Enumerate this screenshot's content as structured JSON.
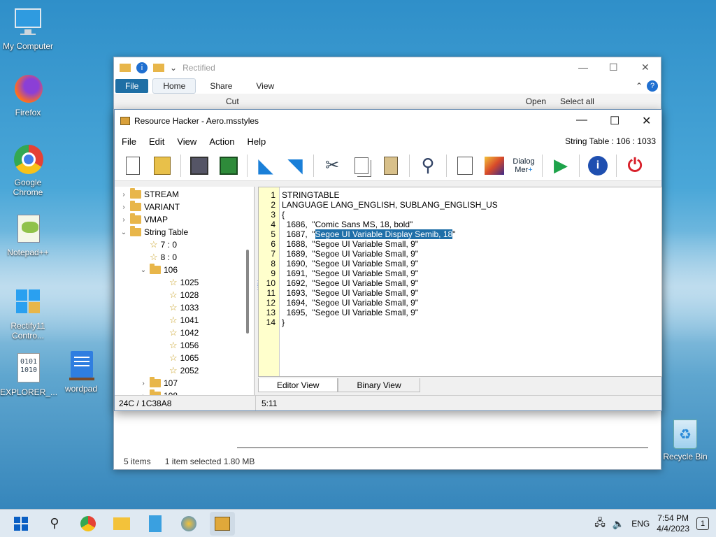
{
  "desktop": {
    "icons": [
      {
        "label": "My Computer",
        "icon": "monitor-icon"
      },
      {
        "label": "Firefox",
        "icon": "firefox-icon"
      },
      {
        "label": "Google Chrome",
        "icon": "chrome-icon"
      },
      {
        "label": "Notepad++",
        "icon": "notepadpp-icon"
      },
      {
        "label": "Rectify11 Contro...",
        "icon": "rectify11-icon"
      },
      {
        "label": "EXPLORER_...",
        "icon": "binary-file-icon"
      },
      {
        "label": "wordpad",
        "icon": "wordpad-icon"
      },
      {
        "label": "Recycle Bin",
        "icon": "recycle-bin-icon"
      }
    ]
  },
  "explorer": {
    "title": "Rectified",
    "ribbon_tabs": [
      "File",
      "Home",
      "Share",
      "View"
    ],
    "ribbon_items": [
      "Cut",
      "Open",
      "Select all"
    ],
    "status": {
      "items": "5 items",
      "selected": "1 item selected  1.80 MB"
    }
  },
  "rh": {
    "title": "Resource Hacker - Aero.msstyles",
    "menu": [
      "File",
      "Edit",
      "View",
      "Action",
      "Help"
    ],
    "menu_info": "String Table : 106 : 1033",
    "toolbar_text": {
      "dialog_line1": "Dialog",
      "dialog_line2": "Mer"
    },
    "tree": [
      {
        "label": "STREAM",
        "type": "folder",
        "chev": "›"
      },
      {
        "label": "VARIANT",
        "type": "folder",
        "chev": "›"
      },
      {
        "label": "VMAP",
        "type": "folder",
        "chev": "›"
      },
      {
        "label": "String Table",
        "type": "folder-open",
        "chev": "⌄"
      },
      {
        "label": "7 : 0",
        "type": "star"
      },
      {
        "label": "8 : 0",
        "type": "star"
      },
      {
        "label": "106",
        "type": "folder-open",
        "chev": "⌄"
      },
      {
        "label": "1025",
        "type": "star"
      },
      {
        "label": "1028",
        "type": "star"
      },
      {
        "label": "1033",
        "type": "star"
      },
      {
        "label": "1041",
        "type": "star"
      },
      {
        "label": "1042",
        "type": "star"
      },
      {
        "label": "1056",
        "type": "star"
      },
      {
        "label": "1065",
        "type": "star"
      },
      {
        "label": "2052",
        "type": "star"
      },
      {
        "label": "107",
        "type": "folder",
        "chev": "›"
      },
      {
        "label": "108",
        "type": "folder",
        "chev": "›"
      }
    ],
    "code": {
      "line_numbers": [
        "1",
        "2",
        "3",
        "4",
        "5",
        "6",
        "7",
        "8",
        "9",
        "10",
        "11",
        "12",
        "13",
        "14"
      ],
      "lines": [
        "STRINGTABLE",
        "LANGUAGE LANG_ENGLISH, SUBLANG_ENGLISH_US",
        "{",
        "  1686,  \"Comic Sans MS, 18, bold\"",
        "  1687,  \"",
        "  1688,  \"Segoe UI Variable Small, 9\"",
        "  1689,  \"Segoe UI Variable Small, 9\"",
        "  1690,  \"Segoe UI Variable Small, 9\"",
        "  1691,  \"Segoe UI Variable Small, 9\"",
        "  1692,  \"Segoe UI Variable Small, 9\"",
        "  1693,  \"Segoe UI Variable Small, 9\"",
        "  1694,  \"Segoe UI Variable Small, 9\"",
        "  1695,  \"Segoe UI Variable Small, 9\"",
        "}"
      ],
      "selected_text": "Segoe UI Variable Display Semib, 18",
      "selected_suffix": "\""
    },
    "tabs": [
      "Editor View",
      "Binary View"
    ],
    "status_offset": "24C / 1C38A8",
    "status_pos": "5:11"
  },
  "taskbar": {
    "apps": [
      "start-icon",
      "search-icon",
      "chrome-icon",
      "file-explorer-icon",
      "notepad-icon",
      "rectify-icon",
      "resource-hacker-icon"
    ],
    "lang": "ENG",
    "time": "7:54 PM",
    "date": "4/4/2023",
    "notif_count": "1"
  }
}
